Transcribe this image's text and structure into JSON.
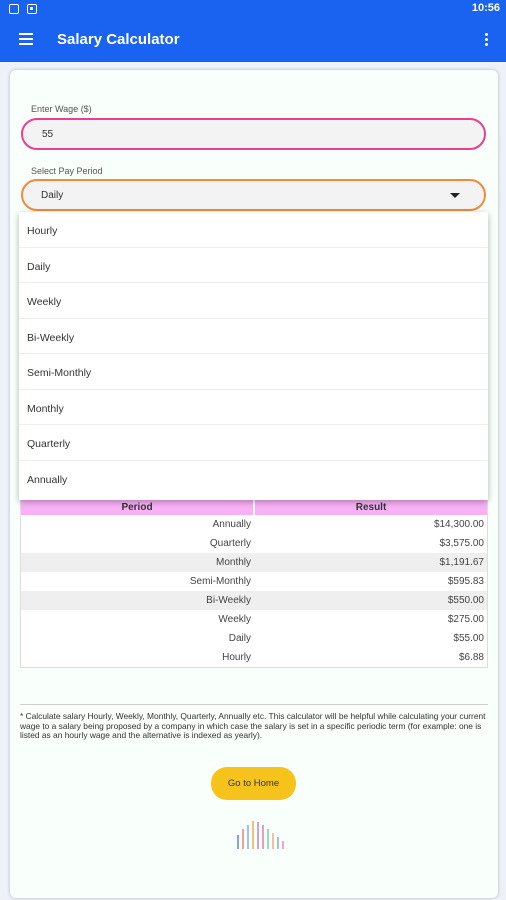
{
  "status_bar": {
    "time": "10:56"
  },
  "app_bar": {
    "title": "Salary Calculator"
  },
  "form": {
    "wage_label": "Enter Wage ($)",
    "wage_value": "55",
    "period_label": "Select Pay Period",
    "period_value": "Daily"
  },
  "dropdown": {
    "options": [
      "Hourly",
      "Daily",
      "Weekly",
      "Bi-Weekly",
      "Semi-Monthly",
      "Monthly",
      "Quarterly",
      "Annually"
    ]
  },
  "results": {
    "headers": [
      "Period",
      "Result"
    ],
    "rows": [
      {
        "period": "Annually",
        "result": "$14,300.00"
      },
      {
        "period": "Quarterly",
        "result": "$3,575.00"
      },
      {
        "period": "Monthly",
        "result": "$1,191.67"
      },
      {
        "period": "Semi-Monthly",
        "result": "$595.83"
      },
      {
        "period": "Bi-Weekly",
        "result": "$550.00"
      },
      {
        "period": "Weekly",
        "result": "$275.00"
      },
      {
        "period": "Daily",
        "result": "$55.00"
      },
      {
        "period": "Hourly",
        "result": "$6.88"
      }
    ]
  },
  "note": "* Calculate salary Hourly, Weekly, Monthly, Quarterly, Annually etc. This calculator will be helpful while calculating your current wage to a salary being proposed by a company in which case the salary is set in a specific periodic term (for example: one is listed as an hourly wage and the alternative is indexed as yearly).",
  "home_button": {
    "label": "Go to Home"
  },
  "colors": {
    "app_bar": "#1a62f0",
    "wage_border": "#ea3f8f",
    "select_border": "#f08a3c",
    "table_header": "#f9b1f6",
    "home_button": "#f5c31c"
  },
  "icons": {
    "menu": "menu-icon",
    "more": "more-vert-icon",
    "dropdown": "chevron-down-icon",
    "loader": "loader-bars-icon"
  }
}
